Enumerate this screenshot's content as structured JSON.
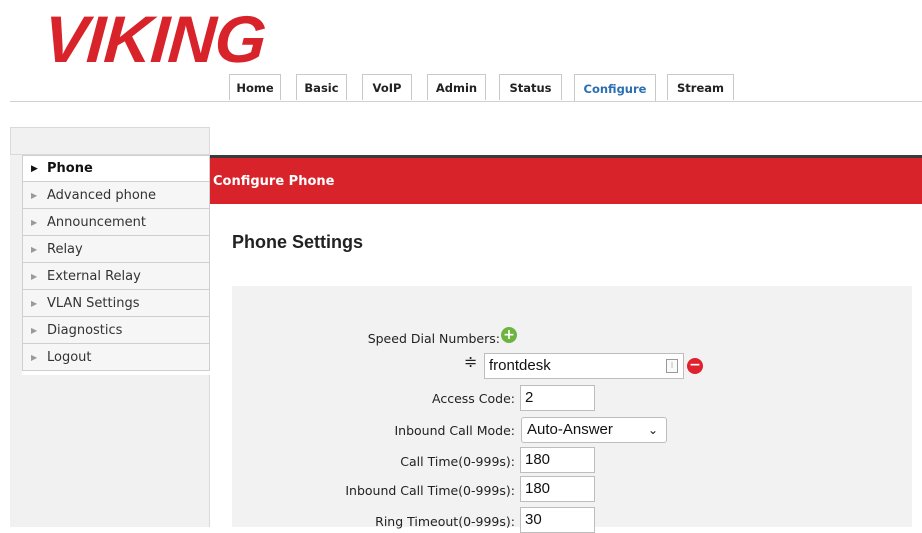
{
  "brand": {
    "logo_text": "VIKING",
    "color": "#d8232a"
  },
  "tabs": [
    {
      "label": "Home"
    },
    {
      "label": "Basic"
    },
    {
      "label": "VoIP"
    },
    {
      "label": "Admin"
    },
    {
      "label": "Status"
    },
    {
      "label": "Configure",
      "active": true
    },
    {
      "label": "Stream"
    }
  ],
  "sidebar": {
    "items": [
      {
        "label": "Phone",
        "selected": true
      },
      {
        "label": "Advanced phone"
      },
      {
        "label": "Announcement"
      },
      {
        "label": "Relay"
      },
      {
        "label": "External Relay"
      },
      {
        "label": "VLAN Settings"
      },
      {
        "label": "Diagnostics"
      },
      {
        "label": "Logout"
      }
    ]
  },
  "header": {
    "title": "Configure Phone"
  },
  "section": {
    "title": "Phone Settings"
  },
  "form": {
    "speed_dial": {
      "label": "Speed Dial Numbers:",
      "entries": [
        "frontdesk"
      ]
    },
    "access_code": {
      "label": "Access Code:",
      "value": "2"
    },
    "inbound_call_mode": {
      "label": "Inbound Call Mode:",
      "value": "Auto-Answer"
    },
    "call_time": {
      "label": "Call Time(0-999s):",
      "value": "180"
    },
    "inbound_call_time": {
      "label": "Inbound Call Time(0-999s):",
      "value": "180"
    },
    "ring_timeout": {
      "label": "Ring Timeout(0-999s):",
      "value": "30"
    }
  },
  "icons": {
    "add": "plus-circle-icon",
    "remove": "minus-circle-icon",
    "reorder": "drag-handle-icon",
    "arrow": "triangle-right-icon"
  }
}
